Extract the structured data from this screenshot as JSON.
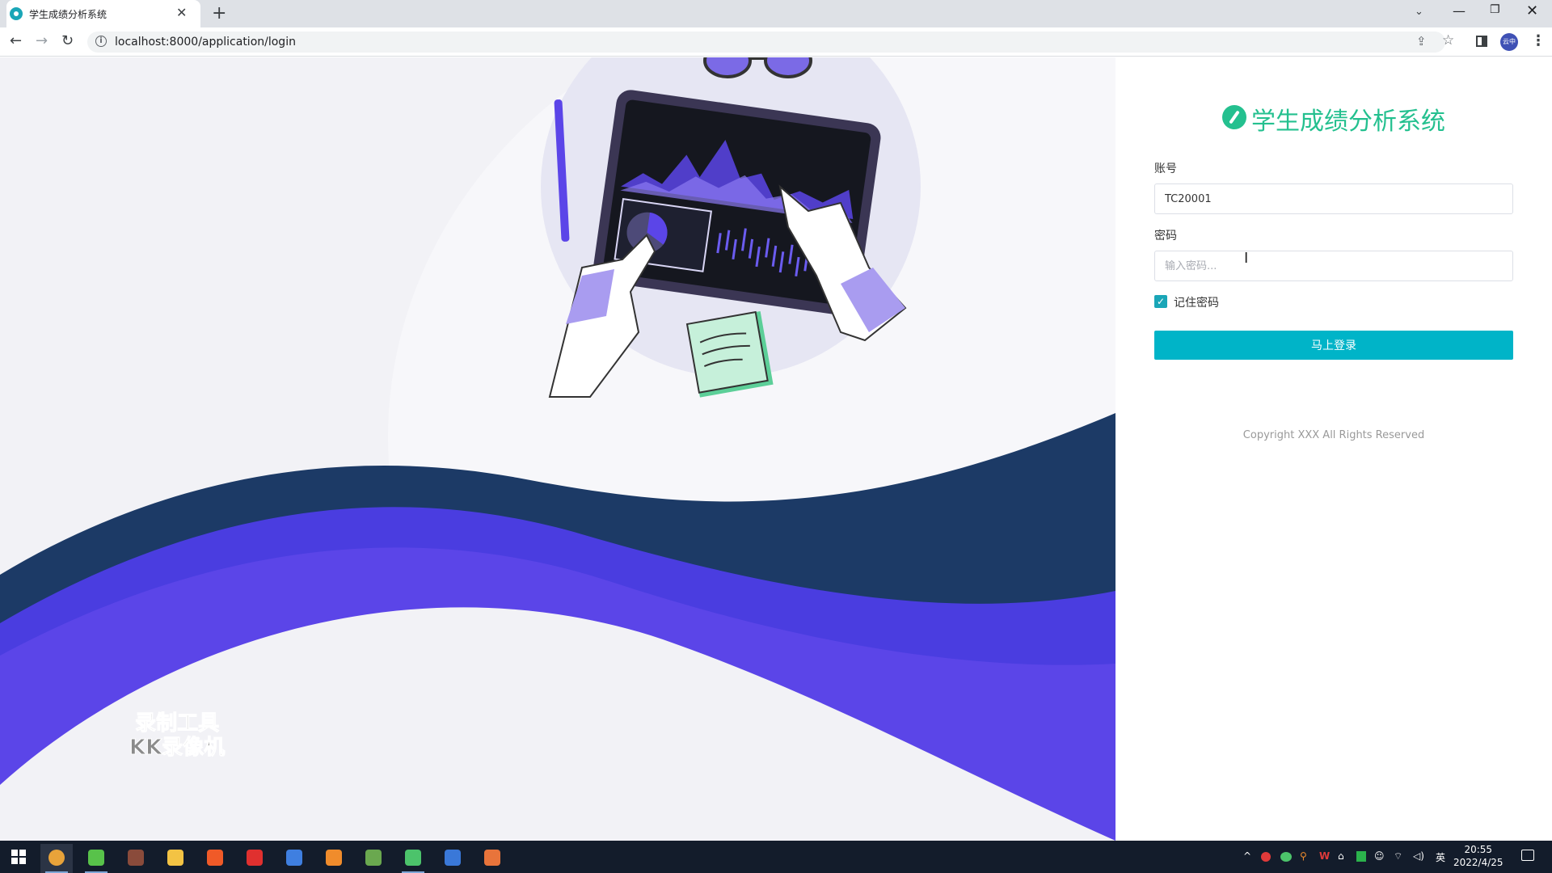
{
  "browser": {
    "tab_title": "学生成绩分析系统",
    "tab_close": "✕",
    "new_tab": "+",
    "url": "localhost:8000/application/login",
    "profile_label": "云中"
  },
  "login": {
    "app_title": "学生成绩分析系统",
    "account_label": "账号",
    "account_value": "TC20001",
    "password_label": "密码",
    "password_placeholder": "输入密码...",
    "remember_label": "记住密码",
    "remember_checked": true,
    "login_button": "马上登录",
    "copyright": "Copyright XXX All Rights Reserved"
  },
  "watermark": {
    "line1": "录制工具",
    "line2": "KK录像机"
  },
  "taskbar": {
    "apps": [
      "chrome-icon",
      "leaf-app-icon",
      "game-app-icon",
      "file-explorer-icon",
      "media-app-icon",
      "wps-icon",
      "network-app-icon",
      "search-tool-icon",
      "notepad-icon",
      "wechat-icon",
      "zoom-tool-icon",
      "emoji-app-icon"
    ],
    "ime": "英",
    "time": "20:55",
    "date": "2022/4/25"
  },
  "colors": {
    "accent_teal": "#00b4c8",
    "logo_green": "#24c08f",
    "wave_navy": "#1c3a66",
    "wave_purple": "#5b45e8"
  }
}
